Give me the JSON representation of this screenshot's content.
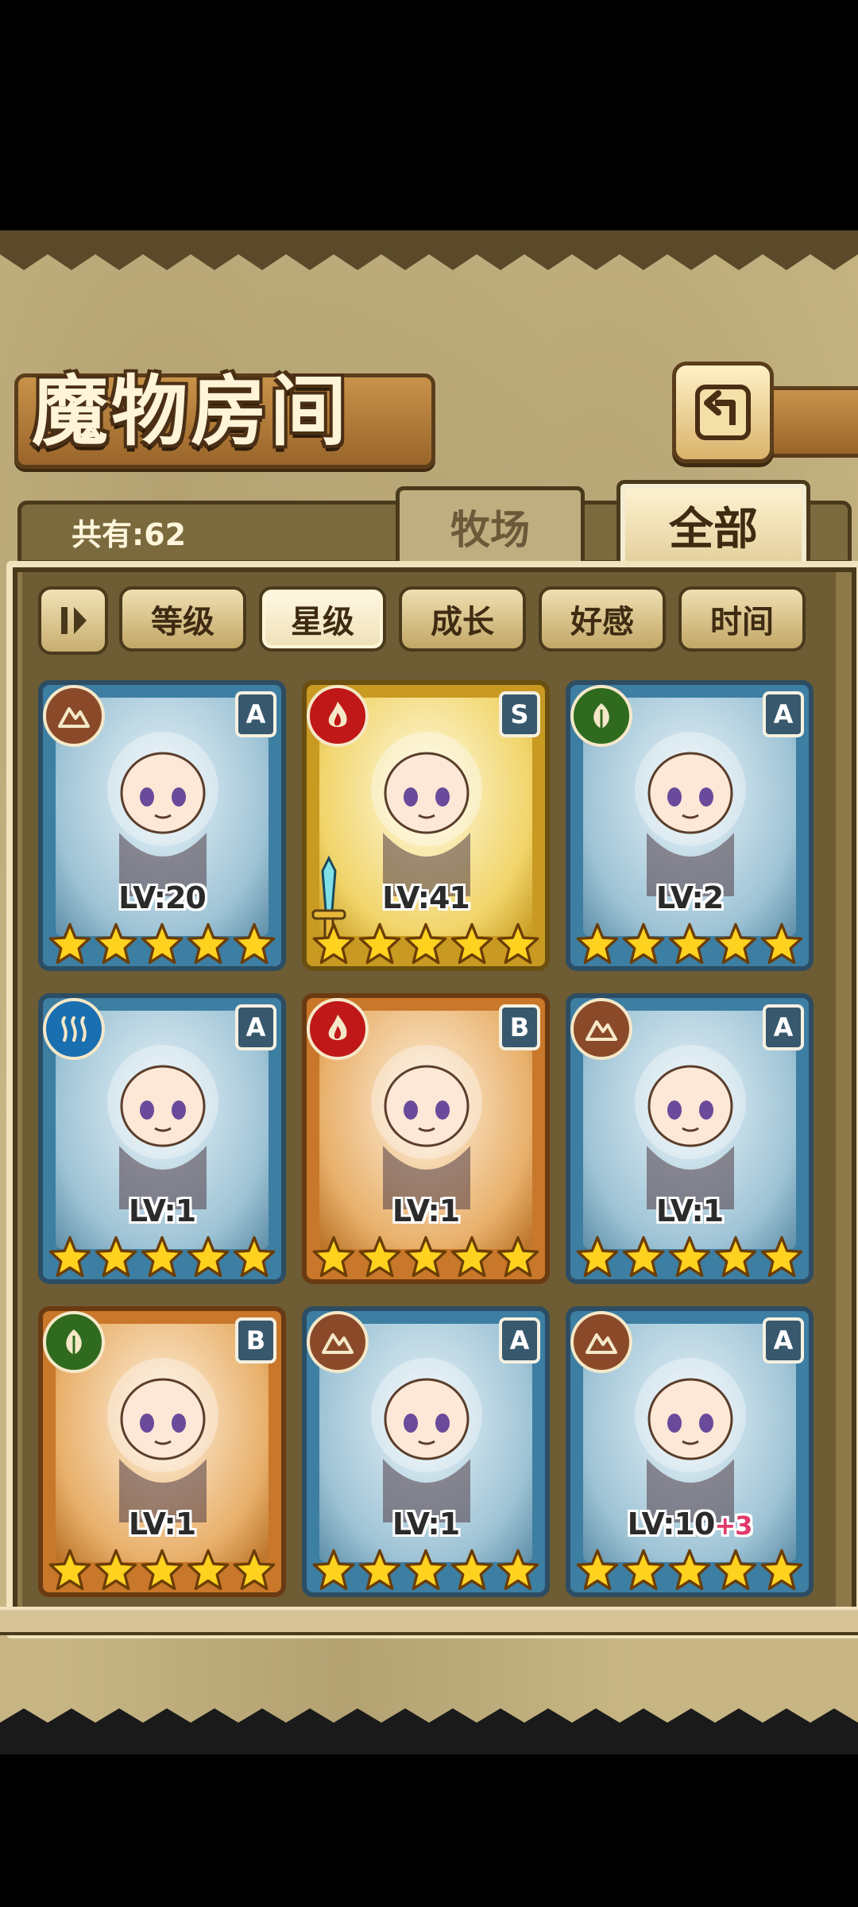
{
  "screen": {
    "title": "魔物房间",
    "count_label": "共有:62"
  },
  "tabs": [
    {
      "label": "牧场",
      "active": false
    },
    {
      "label": "全部",
      "active": true
    }
  ],
  "filters": [
    {
      "label": "等级",
      "active": false
    },
    {
      "label": "星级",
      "active": true
    },
    {
      "label": "成长",
      "active": false
    },
    {
      "label": "好感",
      "active": false
    },
    {
      "label": "时间",
      "active": false
    }
  ],
  "monsters": [
    {
      "element": "earth",
      "rank": "A",
      "frame": "blue",
      "level": "LV:20",
      "bonus": "",
      "stars": 5,
      "weapon": false
    },
    {
      "element": "fire",
      "rank": "S",
      "frame": "gold",
      "level": "LV:41",
      "bonus": "",
      "stars": 5,
      "weapon": true
    },
    {
      "element": "grass",
      "rank": "A",
      "frame": "blue",
      "level": "LV:2",
      "bonus": "",
      "stars": 5,
      "weapon": false
    },
    {
      "element": "water",
      "rank": "A",
      "frame": "blue",
      "level": "LV:1",
      "bonus": "",
      "stars": 5,
      "weapon": false
    },
    {
      "element": "fire",
      "rank": "B",
      "frame": "bronze",
      "level": "LV:1",
      "bonus": "",
      "stars": 5,
      "weapon": false
    },
    {
      "element": "earth",
      "rank": "A",
      "frame": "blue",
      "level": "LV:1",
      "bonus": "",
      "stars": 5,
      "weapon": false
    },
    {
      "element": "grass",
      "rank": "B",
      "frame": "bronze",
      "level": "LV:1",
      "bonus": "",
      "stars": 5,
      "weapon": false
    },
    {
      "element": "earth",
      "rank": "A",
      "frame": "blue",
      "level": "LV:1",
      "bonus": "",
      "stars": 5,
      "weapon": false
    },
    {
      "element": "earth",
      "rank": "A",
      "frame": "blue",
      "level": "LV:10",
      "bonus": "+3",
      "stars": 5,
      "weapon": false
    }
  ],
  "colors": {
    "earth": "#8a4a2a",
    "fire": "#c01818",
    "grass": "#2f6a1e",
    "water": "#1a6fb0",
    "star": "#ffd21f"
  },
  "icons": {
    "back": "return-arrow-icon",
    "sort": "sort-toggle-icon"
  }
}
